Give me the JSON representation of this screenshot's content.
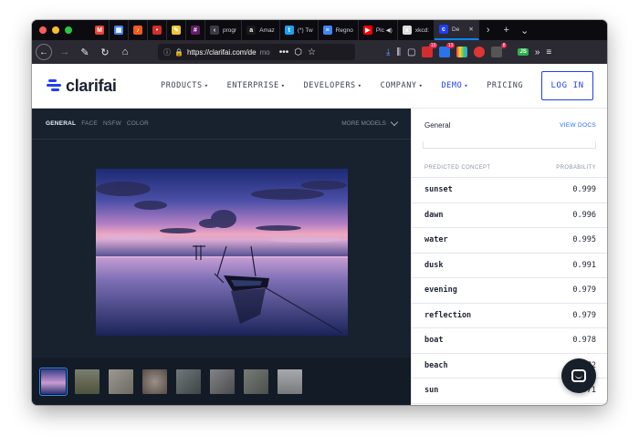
{
  "browser": {
    "traffic_lights": [
      "#ff5f57",
      "#febc2e",
      "#28c840"
    ],
    "tabs": [
      {
        "icon": "gmail-icon",
        "color": "#ea4335",
        "glyph": "M",
        "label": ""
      },
      {
        "icon": "calendar-icon",
        "color": "#4285f4",
        "glyph": "▦",
        "label": ""
      },
      {
        "icon": "music-icon",
        "color": "#f35a1f",
        "glyph": "♪",
        "label": ""
      },
      {
        "icon": "lastpass-icon",
        "color": "#d32d27",
        "glyph": "•",
        "label": ""
      },
      {
        "icon": "notes-icon",
        "color": "#f4c430",
        "glyph": "✎",
        "label": ""
      },
      {
        "icon": "slack-icon",
        "color": "#611f69",
        "glyph": "#",
        "label": ""
      },
      {
        "icon": "back-tab-icon",
        "color": "#3a3a44",
        "glyph": "‹",
        "label": "progr"
      },
      {
        "icon": "amazon-icon",
        "color": "#1a1a1a",
        "glyph": "a",
        "label": "Amaz"
      },
      {
        "icon": "twitter-icon",
        "color": "#1da1f2",
        "glyph": "t",
        "label": "(*) Tw"
      },
      {
        "icon": "docs-icon",
        "color": "#4285f4",
        "glyph": "≡",
        "label": "Regno"
      },
      {
        "icon": "youtube-icon",
        "color": "#ff0000",
        "glyph": "▶",
        "label": "Pic ◀)"
      },
      {
        "icon": "xkcd-icon",
        "color": "#dddddd",
        "glyph": "x",
        "label": "xkcd:"
      },
      {
        "icon": "clarifai-tab-icon",
        "color": "#1f3ff5",
        "glyph": "c",
        "label": "De"
      }
    ],
    "tab_more": "›",
    "new_tab": "+",
    "tab_list": "⌄",
    "url": "https://clarifai.com/de",
    "url_fade": "mo",
    "url_actions": [
      "•••",
      "⬡",
      "☆"
    ],
    "extensions": [
      {
        "icon": "download-icon",
        "glyph": "⤓",
        "color": "#54a0ff"
      },
      {
        "icon": "library-icon",
        "glyph": "⫼",
        "color": "#e8e8ee"
      },
      {
        "icon": "reader-icon",
        "glyph": "▢",
        "color": "#e8e8ee"
      }
    ],
    "badges": [
      "10",
      "13",
      "8"
    ],
    "js_label": "JS"
  },
  "site": {
    "logo": "clarifai",
    "menu": [
      {
        "label": "PRODUCTS",
        "caret": "▾"
      },
      {
        "label": "ENTERPRISE",
        "caret": "▾"
      },
      {
        "label": "DEVELOPERS",
        "caret": "▾"
      },
      {
        "label": "COMPANY",
        "caret": "▾"
      },
      {
        "label": "DEMO",
        "caret": "▾",
        "active": true
      },
      {
        "label": "PRICING",
        "caret": ""
      }
    ],
    "login": "LOG IN",
    "accent": "#1f3ff5"
  },
  "demo": {
    "model_tabs": [
      "GENERAL",
      "FACE",
      "NSFW",
      "COLOR"
    ],
    "active_tab": "GENERAL",
    "more_models": "MORE MODELS",
    "thumbnail_count": 8
  },
  "panel": {
    "title": "General",
    "view_docs": "VIEW DOCS",
    "col_concept": "PREDICTED CONCEPT",
    "col_probability": "PROBABILITY",
    "predictions": [
      {
        "concept": "sunset",
        "probability": "0.999"
      },
      {
        "concept": "dawn",
        "probability": "0.996"
      },
      {
        "concept": "water",
        "probability": "0.995"
      },
      {
        "concept": "dusk",
        "probability": "0.991"
      },
      {
        "concept": "evening",
        "probability": "0.979"
      },
      {
        "concept": "reflection",
        "probability": "0.979"
      },
      {
        "concept": "boat",
        "probability": "0.978"
      },
      {
        "concept": "beach",
        "probability": "0.972"
      },
      {
        "concept": "sun",
        "probability": "0.971"
      }
    ]
  }
}
